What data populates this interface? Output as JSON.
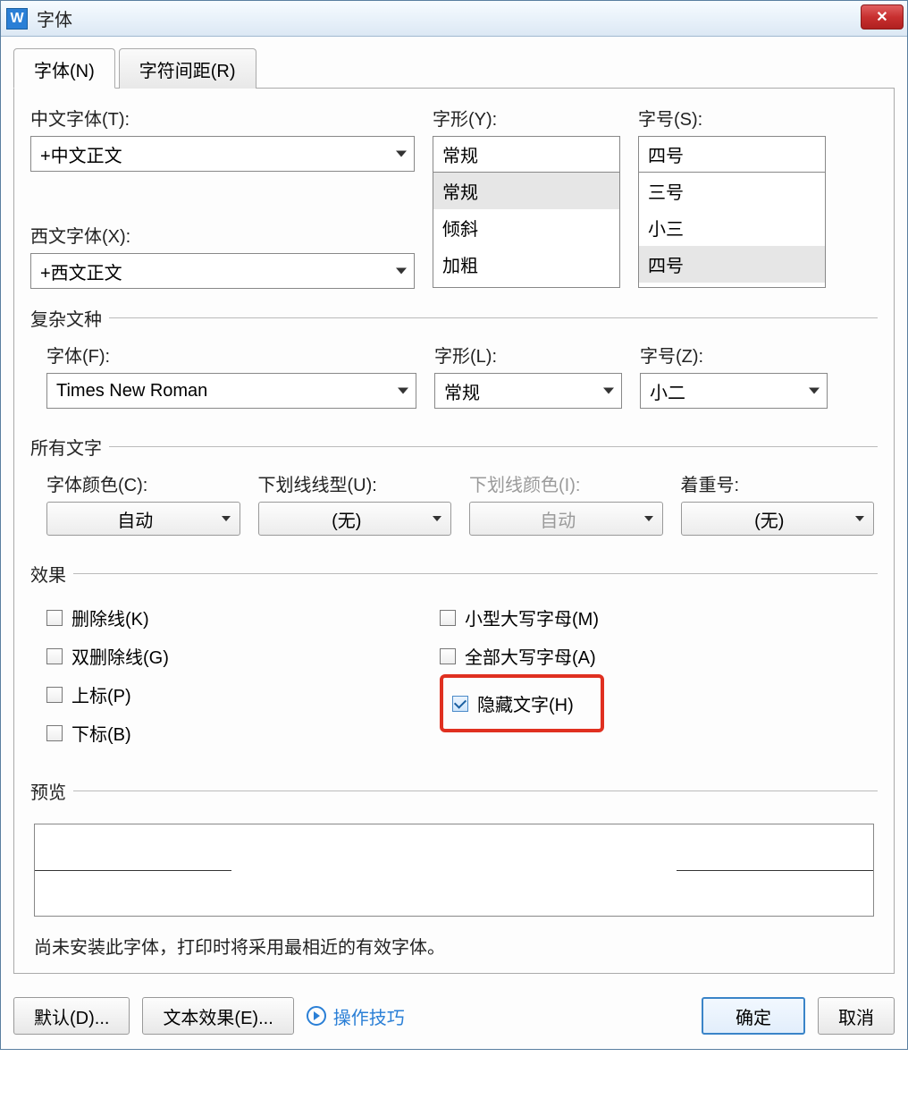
{
  "window": {
    "title": "字体"
  },
  "tabs": {
    "font": "字体(N)",
    "spacing": "字符间距(R)"
  },
  "fields": {
    "cn_font_label": "中文字体(T):",
    "cn_font_value": "+中文正文",
    "style_label": "字形(Y):",
    "style_value": "常规",
    "style_options": [
      "常规",
      "倾斜",
      "加粗"
    ],
    "size_label": "字号(S):",
    "size_value": "四号",
    "size_options": [
      "三号",
      "小三",
      "四号"
    ],
    "western_font_label": "西文字体(X):",
    "western_font_value": "+西文正文"
  },
  "complex": {
    "legend": "复杂文种",
    "font_label": "字体(F):",
    "font_value": "Times New Roman",
    "style_label": "字形(L):",
    "style_value": "常规",
    "size_label": "字号(Z):",
    "size_value": "小二"
  },
  "all_text": {
    "legend": "所有文字",
    "color_label": "字体颜色(C):",
    "color_value": "自动",
    "underline_label": "下划线线型(U):",
    "underline_value": "(无)",
    "underline_color_label": "下划线颜色(I):",
    "underline_color_value": "自动",
    "emphasis_label": "着重号:",
    "emphasis_value": "(无)"
  },
  "effects": {
    "legend": "效果",
    "strike": "删除线(K)",
    "dstrike": "双删除线(G)",
    "sup": "上标(P)",
    "sub": "下标(B)",
    "smallcaps": "小型大写字母(M)",
    "allcaps": "全部大写字母(A)",
    "hidden": "隐藏文字(H)"
  },
  "preview": {
    "legend": "预览"
  },
  "footnote": "尚未安装此字体，打印时将采用最相近的有效字体。",
  "buttons": {
    "default": "默认(D)...",
    "text_effect": "文本效果(E)...",
    "help": "操作技巧",
    "ok": "确定",
    "cancel": "取消"
  }
}
